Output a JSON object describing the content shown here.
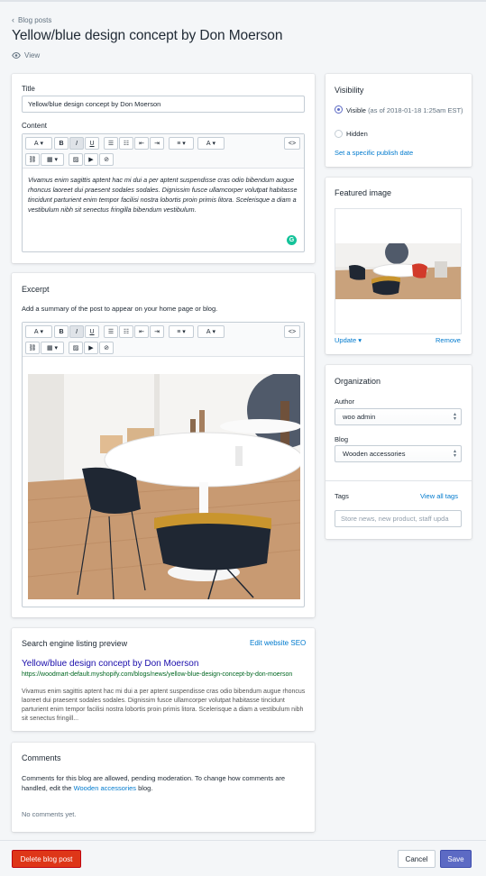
{
  "breadcrumb": "Blog posts",
  "page_title": "Yellow/blue design concept by Don Moerson",
  "view_label": "View",
  "title_card": {
    "title_label": "Title",
    "title_value": "Yellow/blue design concept by Don Moerson",
    "content_label": "Content",
    "content_text": "Vivamus enim sagittis aptent hac mi dui a per aptent suspendisse cras odio bibendum augue rhoncus laoreet dui praesent sodales sodales. Dignissim fusce ullamcorper volutpat habitasse tincidunt parturient enim tempor facilisi nostra lobortis proin primis litora. Scelerisque a diam a vestibulum nibh sit senectus fringilla bibendum vestibulum."
  },
  "toolbar": {
    "paragraph": "A",
    "bold": "B",
    "italic": "I",
    "underline": "U",
    "align": "≡",
    "color": "A",
    "html": "<>"
  },
  "excerpt": {
    "heading": "Excerpt",
    "help": "Add a summary of the post to appear on your home page or blog."
  },
  "seo": {
    "heading": "Search engine listing preview",
    "edit_link": "Edit website SEO",
    "title": "Yellow/blue design concept by Don Moerson",
    "url": "https://woodmart-default.myshopify.com/blogs/news/yellow-blue-design-concept-by-don-moerson",
    "description": "Vivamus enim sagittis aptent hac mi dui a per aptent suspendisse cras odio bibendum augue rhoncus laoreet dui praesent sodales sodales. Dignissim fusce ullamcorper volutpat habitasse tincidunt parturient enim tempor facilisi nostra lobortis proin primis litora. Scelerisque a diam a vestibulum nibh sit senectus fringill..."
  },
  "comments": {
    "heading": "Comments",
    "text_before": "Comments for this blog are allowed, pending moderation. To change how comments are handled, edit the",
    "blog_link": "Wooden accessories",
    "text_after": "blog.",
    "empty": "No comments yet."
  },
  "visibility": {
    "heading": "Visibility",
    "visible_label": "Visible",
    "visible_note": "(as of 2018-01-18 1:25am EST)",
    "hidden_label": "Hidden",
    "publish_link": "Set a specific publish date"
  },
  "featured_image": {
    "heading": "Featured image",
    "update_link": "Update",
    "remove_link": "Remove"
  },
  "organization": {
    "heading": "Organization",
    "author_label": "Author",
    "author_value": "woo admin",
    "blog_label": "Blog",
    "blog_value": "Wooden accessories",
    "tags_label": "Tags",
    "tags_link": "View all tags",
    "tags_placeholder": "Store news, new product, staff upda"
  },
  "footer": {
    "delete": "Delete blog post",
    "cancel": "Cancel",
    "save": "Save"
  },
  "colors": {
    "primary": "#5c6ac4",
    "danger": "#de3618",
    "link": "#007ace"
  },
  "icons": {
    "back": "chevron-left-icon",
    "view": "eye-icon",
    "grammarly": "grammarly-icon"
  }
}
